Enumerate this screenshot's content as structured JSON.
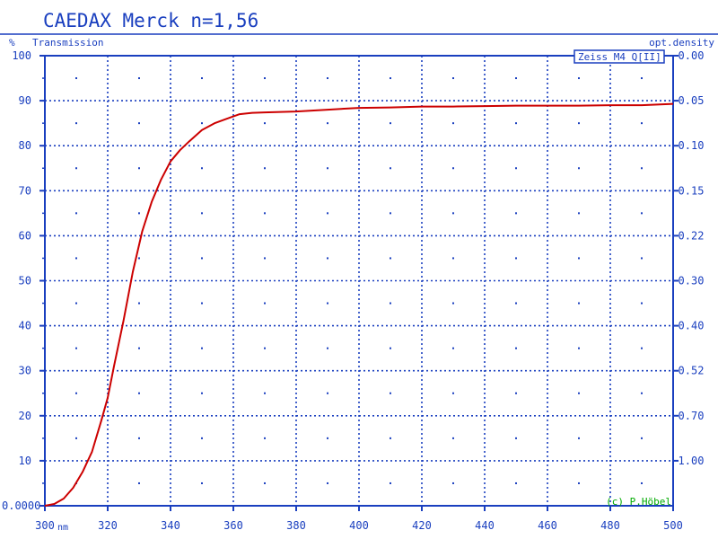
{
  "chart_data": {
    "type": "line",
    "title": "CAEDAX Merck n=1,56",
    "ylabel_left_unit": "%",
    "ylabel_left": "Transmission",
    "ylabel_right": "opt.density",
    "xlabel_unit": "nm",
    "xlim": [
      300,
      500
    ],
    "ylim": [
      0,
      100
    ],
    "x_ticks": [
      300,
      320,
      340,
      360,
      380,
      400,
      420,
      440,
      460,
      480,
      500
    ],
    "y_ticks_left": [
      {
        "value": 0,
        "label": "0.0000"
      },
      {
        "value": 10,
        "label": "10"
      },
      {
        "value": 20,
        "label": "20"
      },
      {
        "value": 30,
        "label": "30"
      },
      {
        "value": 40,
        "label": "40"
      },
      {
        "value": 50,
        "label": "50"
      },
      {
        "value": 60,
        "label": "60"
      },
      {
        "value": 70,
        "label": "70"
      },
      {
        "value": 80,
        "label": "80"
      },
      {
        "value": 90,
        "label": "90"
      },
      {
        "value": 100,
        "label": "100"
      }
    ],
    "y_ticks_right": [
      {
        "value": 100,
        "label": "0.00"
      },
      {
        "value": 90,
        "label": "0.05"
      },
      {
        "value": 80,
        "label": "0.10"
      },
      {
        "value": 70,
        "label": "0.15"
      },
      {
        "value": 60,
        "label": "0.22"
      },
      {
        "value": 50,
        "label": "0.30"
      },
      {
        "value": 40,
        "label": "0.40"
      },
      {
        "value": 30,
        "label": "0.52"
      },
      {
        "value": 20,
        "label": "0.70"
      },
      {
        "value": 10,
        "label": "1.00"
      }
    ],
    "grid": true,
    "legend_box": "Zeiss M4 Q[II]",
    "credit": "(c) P.Höbel",
    "series": [
      {
        "color": "#cc0000",
        "x": [
          300,
          303,
          306,
          309,
          312,
          315,
          318,
          320,
          322,
          325,
          328,
          331,
          334,
          337,
          340,
          343,
          346,
          350,
          354,
          358,
          362,
          366,
          370,
          380,
          390,
          400,
          410,
          420,
          430,
          440,
          450,
          460,
          470,
          480,
          490,
          500
        ],
        "y": [
          0,
          0.4,
          1.6,
          4,
          7.5,
          12,
          19,
          24,
          31,
          41,
          52,
          61,
          67.5,
          72.5,
          76.5,
          79,
          81,
          83.5,
          85,
          86,
          87,
          87.3,
          87.4,
          87.6,
          88,
          88.4,
          88.5,
          88.7,
          88.7,
          88.8,
          88.9,
          88.9,
          88.9,
          89,
          89,
          89.3
        ]
      }
    ]
  },
  "colors": {
    "axis": "#1a3fbf",
    "title": "#1a3fbf",
    "grid": "#1a3fbf",
    "curve": "#cc0000",
    "credit": "#00aa00"
  }
}
